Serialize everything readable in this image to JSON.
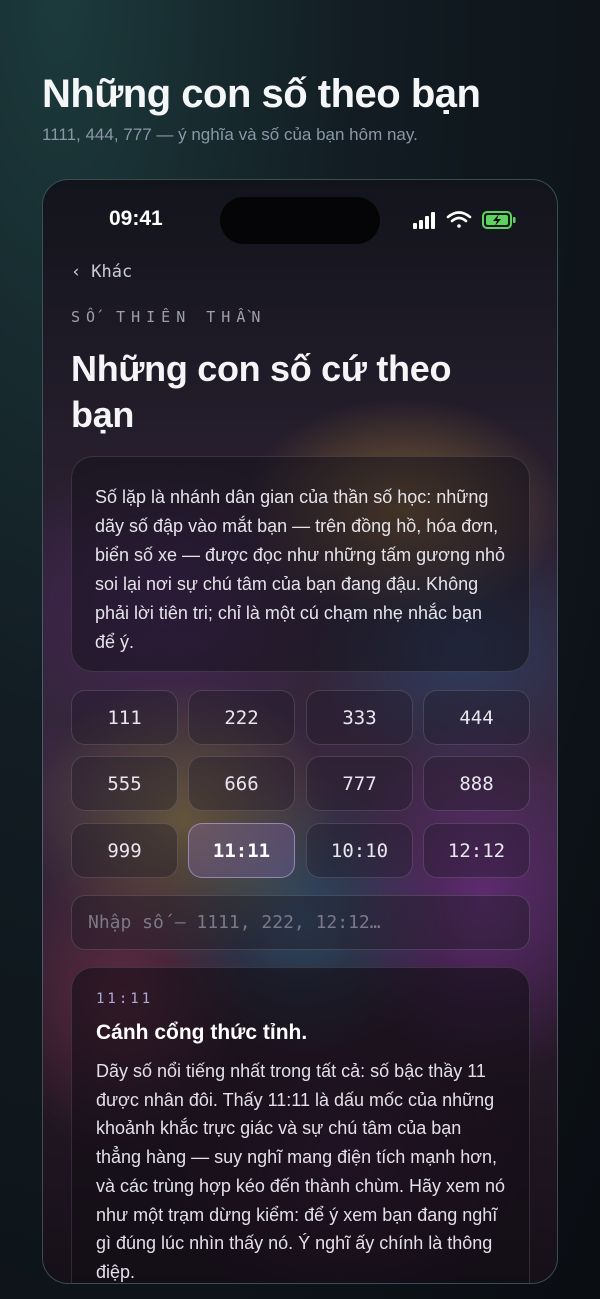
{
  "page": {
    "title": "Những con số theo bạn",
    "subtitle": "1111, 444, 777 — ý nghĩa và số của bạn hôm nay."
  },
  "status_bar": {
    "time": "09:41",
    "icons": [
      "signal-icon",
      "wifi-icon",
      "battery-charging-icon"
    ]
  },
  "nav": {
    "back_label": "Khác"
  },
  "eyebrow": "SỐ THIÊN THẦN",
  "heading": "Những con số cứ theo bạn",
  "intro": "Số lặp là nhánh dân gian của thần số học: những dãy số đập vào mắt bạn — trên đồng hồ, hóa đơn, biển số xe — được đọc như những tấm gương nhỏ soi lại nơi sự chú tâm của bạn đang đậu. Không phải lời tiên tri; chỉ là một cú chạm nhẹ nhắc bạn để ý.",
  "numbers": [
    "111",
    "222",
    "333",
    "444",
    "555",
    "666",
    "777",
    "888",
    "999",
    "11:11",
    "10:10",
    "12:12"
  ],
  "selected_number": "11:11",
  "search": {
    "placeholder": "Nhập số — 1111, 222, 12:12…",
    "value": ""
  },
  "detail": {
    "label": "11:11",
    "title": "Cánh cổng thức tỉnh.",
    "body": "Dãy số nổi tiếng nhất trong tất cả: số bậc thầy 11 được nhân đôi. Thấy 11:11 là dấu mốc của những khoảnh khắc trực giác và sự chú tâm của bạn thẳng hàng — suy nghĩ mang điện tích mạnh hơn, và các trùng hợp kéo đến thành chùm. Hãy xem nó như một trạm dừng kiểm: để ý xem bạn đang nghĩ gì đúng lúc nhìn thấy nó. Ý nghĩ ấy chính là thông điệp."
  },
  "colors": {
    "accent": "#b0a8d8",
    "battery": "#5fd35f"
  }
}
